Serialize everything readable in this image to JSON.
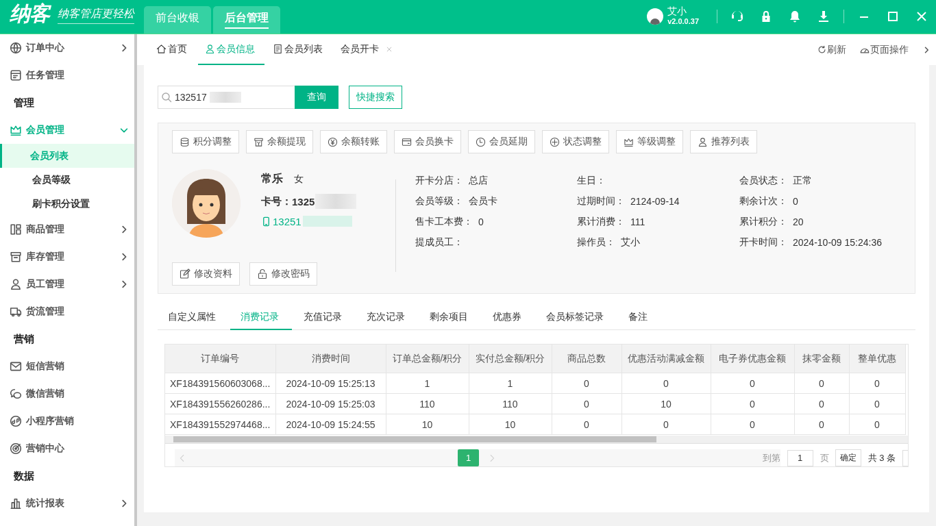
{
  "header": {
    "logo": "纳客",
    "slogan": "纳客管店更轻松",
    "tabs": [
      {
        "label": "前台收银",
        "selected": false
      },
      {
        "label": "后台管理",
        "selected": true
      }
    ],
    "user": {
      "name": "艾小",
      "version": "v2.0.0.37"
    }
  },
  "sidebar": {
    "items": [
      {
        "kind": "folder",
        "label": "订单中心",
        "expanded": false,
        "selected": false
      },
      {
        "kind": "link",
        "label": "任务管理",
        "selected": false
      },
      {
        "kind": "heading",
        "label": "管理"
      },
      {
        "kind": "folder",
        "label": "会员管理",
        "expanded": true,
        "selected": false,
        "children": [
          {
            "label": "会员列表",
            "selected": true
          },
          {
            "label": "会员等级",
            "selected": false
          },
          {
            "label": "刷卡积分设置",
            "selected": false
          }
        ]
      },
      {
        "kind": "folder",
        "label": "商品管理",
        "expanded": false,
        "selected": false
      },
      {
        "kind": "folder",
        "label": "库存管理",
        "expanded": false,
        "selected": false
      },
      {
        "kind": "folder",
        "label": "员工管理",
        "expanded": false,
        "selected": false
      },
      {
        "kind": "link",
        "label": "货流管理",
        "selected": false
      },
      {
        "kind": "heading",
        "label": "营销"
      },
      {
        "kind": "link",
        "label": "短信营销",
        "selected": false
      },
      {
        "kind": "link",
        "label": "微信营销",
        "selected": false
      },
      {
        "kind": "link",
        "label": "小程序营销",
        "selected": false
      },
      {
        "kind": "link",
        "label": "营销中心",
        "selected": false
      },
      {
        "kind": "heading",
        "label": "数据"
      },
      {
        "kind": "folder",
        "label": "统计报表",
        "expanded": false,
        "selected": false
      }
    ]
  },
  "page_tabs": {
    "tabs": [
      {
        "label": "首页",
        "selected": false,
        "closable": false
      },
      {
        "label": "会员信息",
        "selected": true,
        "closable": false
      },
      {
        "label": "会员列表",
        "selected": false,
        "closable": false
      },
      {
        "label": "会员开卡",
        "selected": false,
        "closable": true
      }
    ],
    "refresh": "刷新",
    "page_actions": "页面操作"
  },
  "search": {
    "value": "132517",
    "button": "查询",
    "quick_search": "快捷搜索"
  },
  "actions": [
    "积分调整",
    "余额提现",
    "余额转账",
    "会员换卡",
    "会员延期",
    "状态调整",
    "等级调整",
    "推荐列表"
  ],
  "member": {
    "name": "常乐",
    "gender": "女",
    "card_label": "卡号：",
    "card_number": "1325",
    "phone": "13251",
    "edit_buttons": [
      "修改资料",
      "修改密码"
    ],
    "fields": [
      {
        "label": "开卡分店：",
        "value": "总店"
      },
      {
        "label": "生日："
      },
      {
        "label": "会员状态：",
        "value": "正常"
      },
      {
        "label": "会员等级：",
        "value": "会员卡"
      },
      {
        "label": "过期时间：",
        "value": "2124-09-14"
      },
      {
        "label": "剩余计次：",
        "value": "0"
      },
      {
        "label": "售卡工本费：",
        "value": "0"
      },
      {
        "label": "累计消费：",
        "value": "111"
      },
      {
        "label": "累计积分：",
        "value": "20"
      },
      {
        "label": "提成员工："
      },
      {
        "label": "操作员：",
        "value": "艾小"
      },
      {
        "label": "开卡时间：",
        "value": "2024-10-09 15:24:36"
      }
    ]
  },
  "detail_tabs": [
    {
      "label": "自定义属性",
      "selected": false
    },
    {
      "label": "消费记录",
      "selected": true
    },
    {
      "label": "充值记录",
      "selected": false
    },
    {
      "label": "充次记录",
      "selected": false
    },
    {
      "label": "剩余项目",
      "selected": false
    },
    {
      "label": "优惠券",
      "selected": false
    },
    {
      "label": "会员标签记录",
      "selected": false
    },
    {
      "label": "备注",
      "selected": false
    }
  ],
  "table": {
    "columns": [
      "订单编号",
      "消费时间",
      "订单总金额/积分",
      "实付总金额/积分",
      "商品总数",
      "优惠活动满减金额",
      "电子券优惠金额",
      "抹零金额",
      "整单优惠"
    ],
    "rows": [
      [
        "XF184391560603068...",
        "2024-10-09 15:25:13",
        "1",
        "1",
        "0",
        "0",
        "0",
        "0",
        "0"
      ],
      [
        "XF184391556260286...",
        "2024-10-09 15:25:03",
        "110",
        "110",
        "0",
        "10",
        "0",
        "0",
        "0"
      ],
      [
        "XF184391552974468...",
        "2024-10-09 15:24:55",
        "10",
        "10",
        "0",
        "0",
        "0",
        "0",
        "0"
      ]
    ]
  },
  "pagination": {
    "pages": [
      {
        "label": "1",
        "selected": true
      }
    ],
    "goto_label": "到第",
    "goto_value": "1",
    "page_unit": "页",
    "confirm": "确定",
    "total": "共 3 条"
  }
}
